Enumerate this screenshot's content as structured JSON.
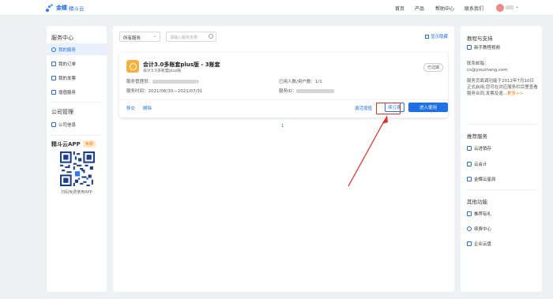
{
  "header": {
    "logo_text": "金蝶",
    "logo_sub": "精斗云",
    "nav": [
      "首页",
      "产品",
      "帮助中心",
      "联系我们"
    ],
    "accent": "#1f6fe5"
  },
  "sidebar": {
    "section1": "服务中心",
    "items1": [
      "我的服务",
      "我的订单",
      "我的发票",
      "增值服务"
    ],
    "section2": "公司管理",
    "items2": [
      "公司信息"
    ],
    "app_title": "精斗云APP",
    "app_badge": "免费",
    "qr_caption": "扫码免费使用APP"
  },
  "main": {
    "filter_select": "所有服务",
    "search_placeholder": "请输入服务名称",
    "toggle_expired": "显示隐藏",
    "card": {
      "product_name": "会计3.0多账套plus版 - 3账套",
      "product_sub": "会计3.0多账套plus版",
      "status": "已过期",
      "admin_label": "服务管理员：",
      "admin_suffix": ")",
      "period_label": "服务时间：",
      "period_value": "2021/06/30—2021/07/31",
      "users_label": "已用人数/用户数：",
      "users_value": "1/1",
      "id_label": "服务ID：",
      "actions": {
        "transfer": "移交",
        "delete": "删除",
        "activate": "激活增值",
        "renew": "续订费",
        "enter": "进入使用"
      }
    },
    "page": "1"
  },
  "right": {
    "support_title": "教程与支持",
    "tutorial_link": "新手教程视频",
    "contact_label": "联系邮箱：",
    "contact_email": "cs@youshang.com",
    "notice_text": "服务页面调功能于2012年7月10日正式启用,您可在对应服务栏目里查看服务合同,发票及退...",
    "notice_more": "更多>>",
    "recommend_title": "推荐服务",
    "recommend": [
      "云进销存",
      "云会计",
      "金蝶云星辰"
    ],
    "other_title": "其他功能",
    "other": [
      "推荐有礼",
      "续费中心",
      "企业云盘"
    ]
  }
}
